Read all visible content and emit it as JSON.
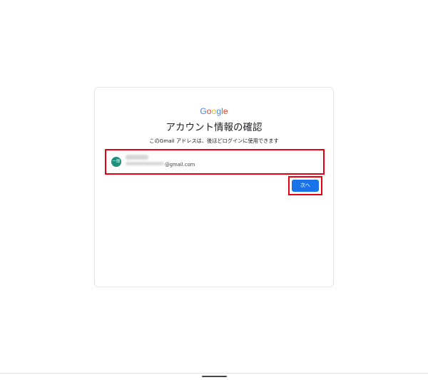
{
  "logo": {
    "text": "Google",
    "letters": [
      "G",
      "o",
      "o",
      "g",
      "l",
      "e"
    ],
    "colors": [
      "#4285F4",
      "#EA4335",
      "#FBBC05",
      "#4285F4",
      "#34A853",
      "#EA4335"
    ]
  },
  "title": "アカウント情報の確認",
  "subtitle": "このGmail アドレスは、後ほどログインに使用できます",
  "account": {
    "avatar_initials": "一郎",
    "avatar_color": "#1E8E7E",
    "email_suffix": "@gmail.com"
  },
  "actions": {
    "next_label": "次へ",
    "next_color": "#1A73E8"
  },
  "highlight_color": "#E60012"
}
